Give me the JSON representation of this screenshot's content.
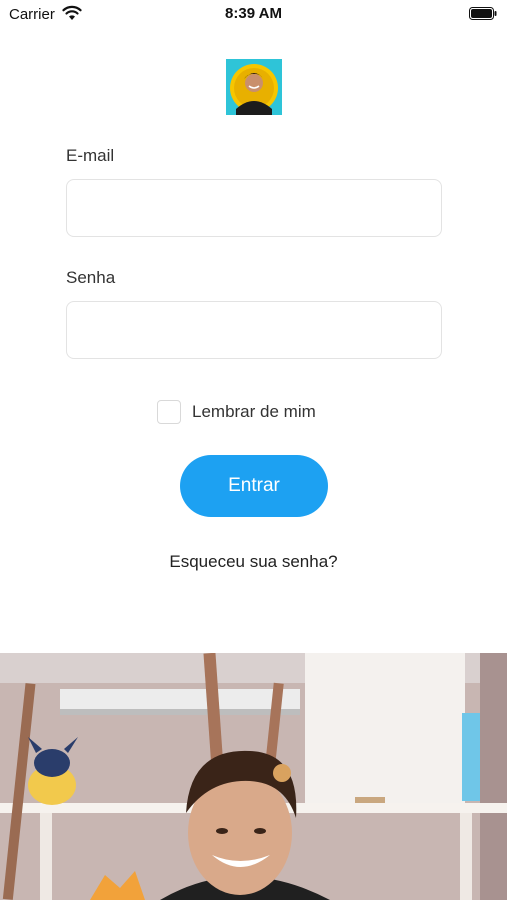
{
  "status_bar": {
    "carrier": "Carrier",
    "time": "8:39 AM",
    "wifi_icon": "wifi-icon",
    "battery_icon": "battery-icon"
  },
  "logo": {
    "icon": "avatar-logo"
  },
  "form": {
    "email_label": "E-mail",
    "email_value": "",
    "password_label": "Senha",
    "password_value": "",
    "remember_label": "Lembrar de mim",
    "remember_checked": false,
    "submit_label": "Entrar",
    "forgot_label": "Esqueceu sua senha?"
  },
  "colors": {
    "primary": "#1da1f2",
    "logo_bg": "#2ec4d8",
    "logo_ring": "#f7c600"
  },
  "photo": {
    "subject": "hero-photo"
  }
}
